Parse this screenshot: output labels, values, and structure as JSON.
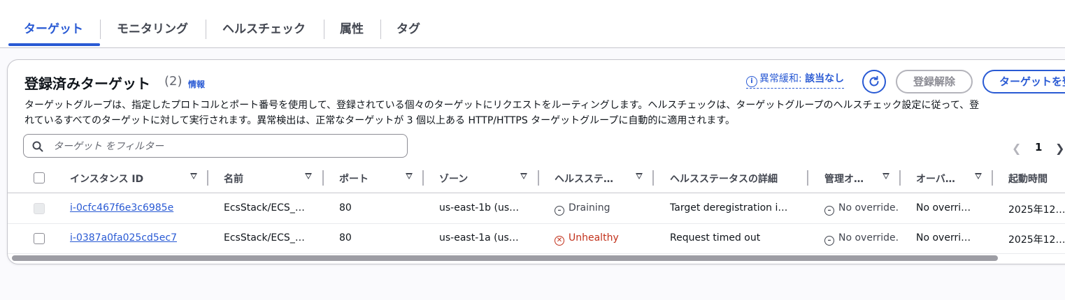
{
  "tabs": [
    {
      "label": "ターゲット",
      "active": true
    },
    {
      "label": "モニタリング",
      "active": false
    },
    {
      "label": "ヘルスチェック",
      "active": false
    },
    {
      "label": "属性",
      "active": false
    },
    {
      "label": "タグ",
      "active": false
    }
  ],
  "panel": {
    "title": "登録済みターゲット",
    "count": "(2)",
    "info_link": "情報",
    "description_line1": "ターゲットグループは、指定したプロトコルとポート番号を使用して、登録されている個々のターゲットにリクエストをルーティングします。ヘルスチェックは、ターゲットグループのヘルスチェック設定に従って、登",
    "description_line2": "れているすべてのターゲットに対して実行されます。異常検出は、正常なターゲットが 3 個以上ある HTTP/HTTPS ターゲットグループに自動的に適用されます。",
    "anomaly_label": "異常緩和:",
    "anomaly_value": "該当なし",
    "deregister_button": "登録解除",
    "register_button": "ターゲットを登録",
    "filter_placeholder": "ターゲット をフィルター",
    "page_number": "1"
  },
  "table": {
    "columns": [
      "インスタンス ID",
      "名前",
      "ポート",
      "ゾーン",
      "ヘルスステ…",
      "ヘルスステータスの詳細",
      "管理オ…",
      "オーバ…",
      "起動時間"
    ],
    "rows": [
      {
        "instance_id": "i-0cfc467f6e3c6985e",
        "name": "EcsStack/ECS_…",
        "port": "80",
        "zone": "us-east-1b (us…",
        "health_status": "Draining",
        "health_detail": "Target deregistration i…",
        "admin_override": "No override.",
        "override": "No overri…",
        "launch_time": "2025年12…",
        "checkbox_disabled": true
      },
      {
        "instance_id": "i-0387a0fa025cd5ec7",
        "name": "EcsStack/ECS_…",
        "port": "80",
        "zone": "us-east-1a (us…",
        "health_status": "Unhealthy",
        "health_detail": "Request timed out",
        "admin_override": "No override.",
        "override": "No overri…",
        "launch_time": "2025年12…",
        "checkbox_disabled": false
      }
    ]
  },
  "colors": {
    "accent": "#295ad4",
    "error": "#c2311b",
    "text": "#0f141a",
    "muted": "#424650"
  }
}
